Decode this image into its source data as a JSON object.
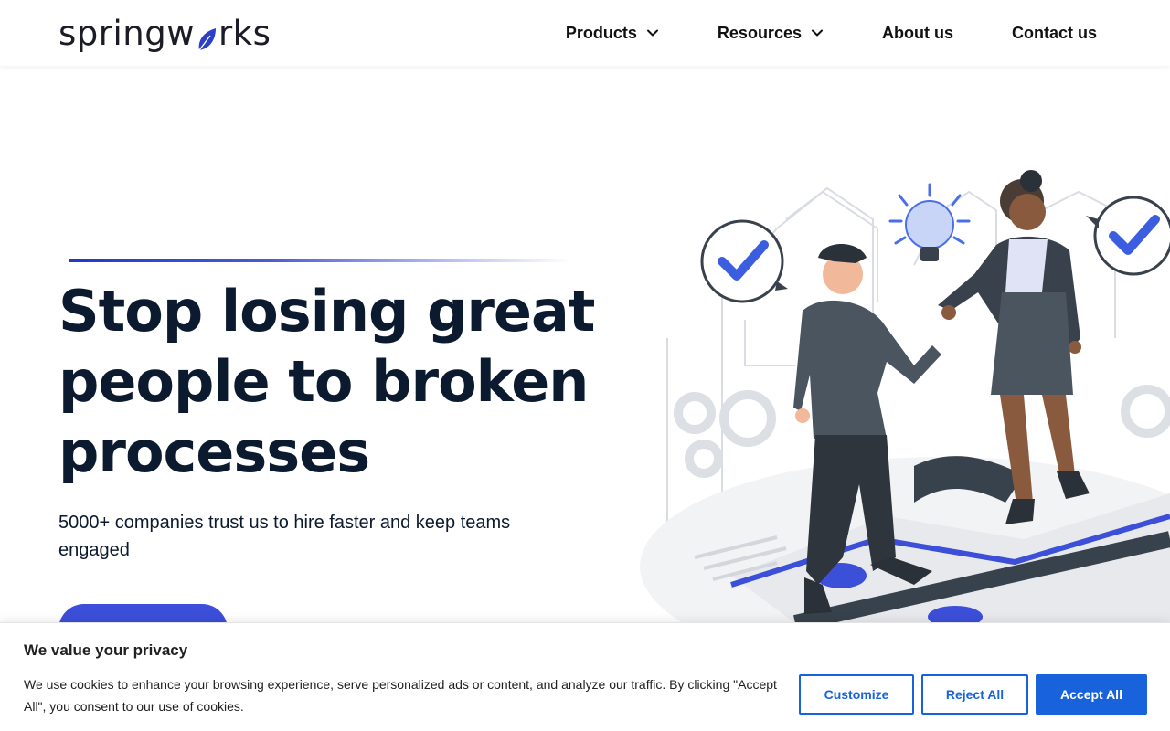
{
  "header": {
    "logo_prefix": "spring",
    "logo_suffix": "rks",
    "nav": [
      {
        "label": "Products",
        "has_dropdown": true
      },
      {
        "label": "Resources",
        "has_dropdown": true
      },
      {
        "label": "About us",
        "has_dropdown": false
      },
      {
        "label": "Contact us",
        "has_dropdown": false
      }
    ]
  },
  "hero": {
    "title_line1": "Stop losing great",
    "title_line2": "people to broken",
    "title_line3": "processes",
    "subtitle": "5000+ companies trust us to hire faster and keep teams engaged"
  },
  "cookie_banner": {
    "title": "We value your privacy",
    "text": "We use cookies to enhance your browsing experience, serve personalized ads or content, and analyze our traffic. By clicking \"Accept All\", you consent to our use of cookies.",
    "customize_label": "Customize",
    "reject_label": "Reject All",
    "accept_label": "Accept All"
  },
  "colors": {
    "brand_blue": "#3b4fd8",
    "cookie_blue": "#1863dc",
    "heading": "#0b1a2e"
  }
}
